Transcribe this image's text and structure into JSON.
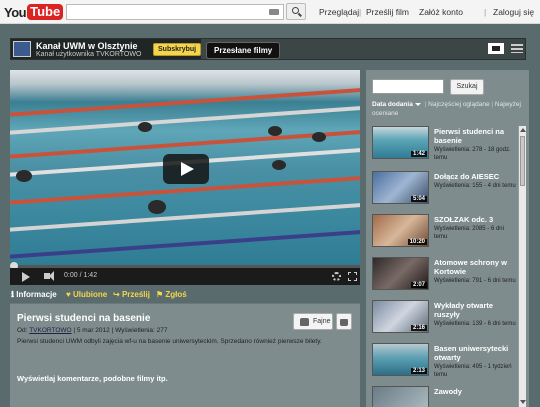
{
  "topbar": {
    "logo_you": "You",
    "logo_tube": "Tube",
    "links": [
      "Przeglądaj",
      "Prześlij film",
      "Załóż konto",
      "Zaloguj się"
    ],
    "link_separator": "|"
  },
  "channel": {
    "name": "Kanał UWM w Olsztynie",
    "subtitle": "Kanał użytkownika TVKORTOWO",
    "subscribe_label": "Subskrybuj",
    "uploads_tab": "Przesłane filmy"
  },
  "player": {
    "time": "0:00 / 1:42",
    "progress_fraction": 0.0
  },
  "info_tabs": [
    {
      "label": "Informacje",
      "color": "#ffffff"
    },
    {
      "label": "Ulubione",
      "color": "#f5d54a"
    },
    {
      "label": "Prześlij",
      "color": "#f5d54a"
    },
    {
      "label": "Zgłoś",
      "color": "#f5d54a"
    }
  ],
  "video": {
    "title": "Pierwsi studenci na basenie",
    "meta_prefix": "Od:",
    "author": "TVKORTOWO",
    "date": "5 mar 2012",
    "views": "Wyświetlenia: 277",
    "meta_sep": "|",
    "description": "Pierwsi studenci UWM odbyli zajęcia wf-u na basenie uniwersyteckim. Sprzedano również pierwsze bilety.",
    "like_label": "Fajne",
    "comments_link": "Wyświetlaj komentarze, podobne filmy itp."
  },
  "sidebar": {
    "search_button": "Szukaj",
    "sort_active": "Data dodania",
    "sort_links": [
      "Najczęściej oglądane",
      "Najwyżej oceniane"
    ],
    "sort_sep": "|",
    "items": [
      {
        "title": "Pierwsi studenci na basenie",
        "views": "Wyświetlenia: 278 - 18 godz. temu",
        "duration": "1:42"
      },
      {
        "title": "Dołącz do AIESEC",
        "views": "Wyświetlenia: 155 - 4 dni temu",
        "duration": "5:04"
      },
      {
        "title": "SZOŁZAK odc. 3",
        "views": "Wyświetlenia: 2085 - 6 dni temu",
        "duration": "10:20"
      },
      {
        "title": "Atomowe schrony w Kortowie",
        "views": "Wyświetlenia: 791 - 6 dni temu",
        "duration": "2:07"
      },
      {
        "title": "Wykłady otwarte ruszyły",
        "views": "Wyświetlenia: 139 - 6 dni temu",
        "duration": "2:16"
      },
      {
        "title": "Basen uniwersytecki otwarty",
        "views": "Wyświetlenia: 495 - 1 tydzień temu",
        "duration": "2:13"
      },
      {
        "title": "Zawody",
        "views": "",
        "duration": ""
      }
    ]
  }
}
